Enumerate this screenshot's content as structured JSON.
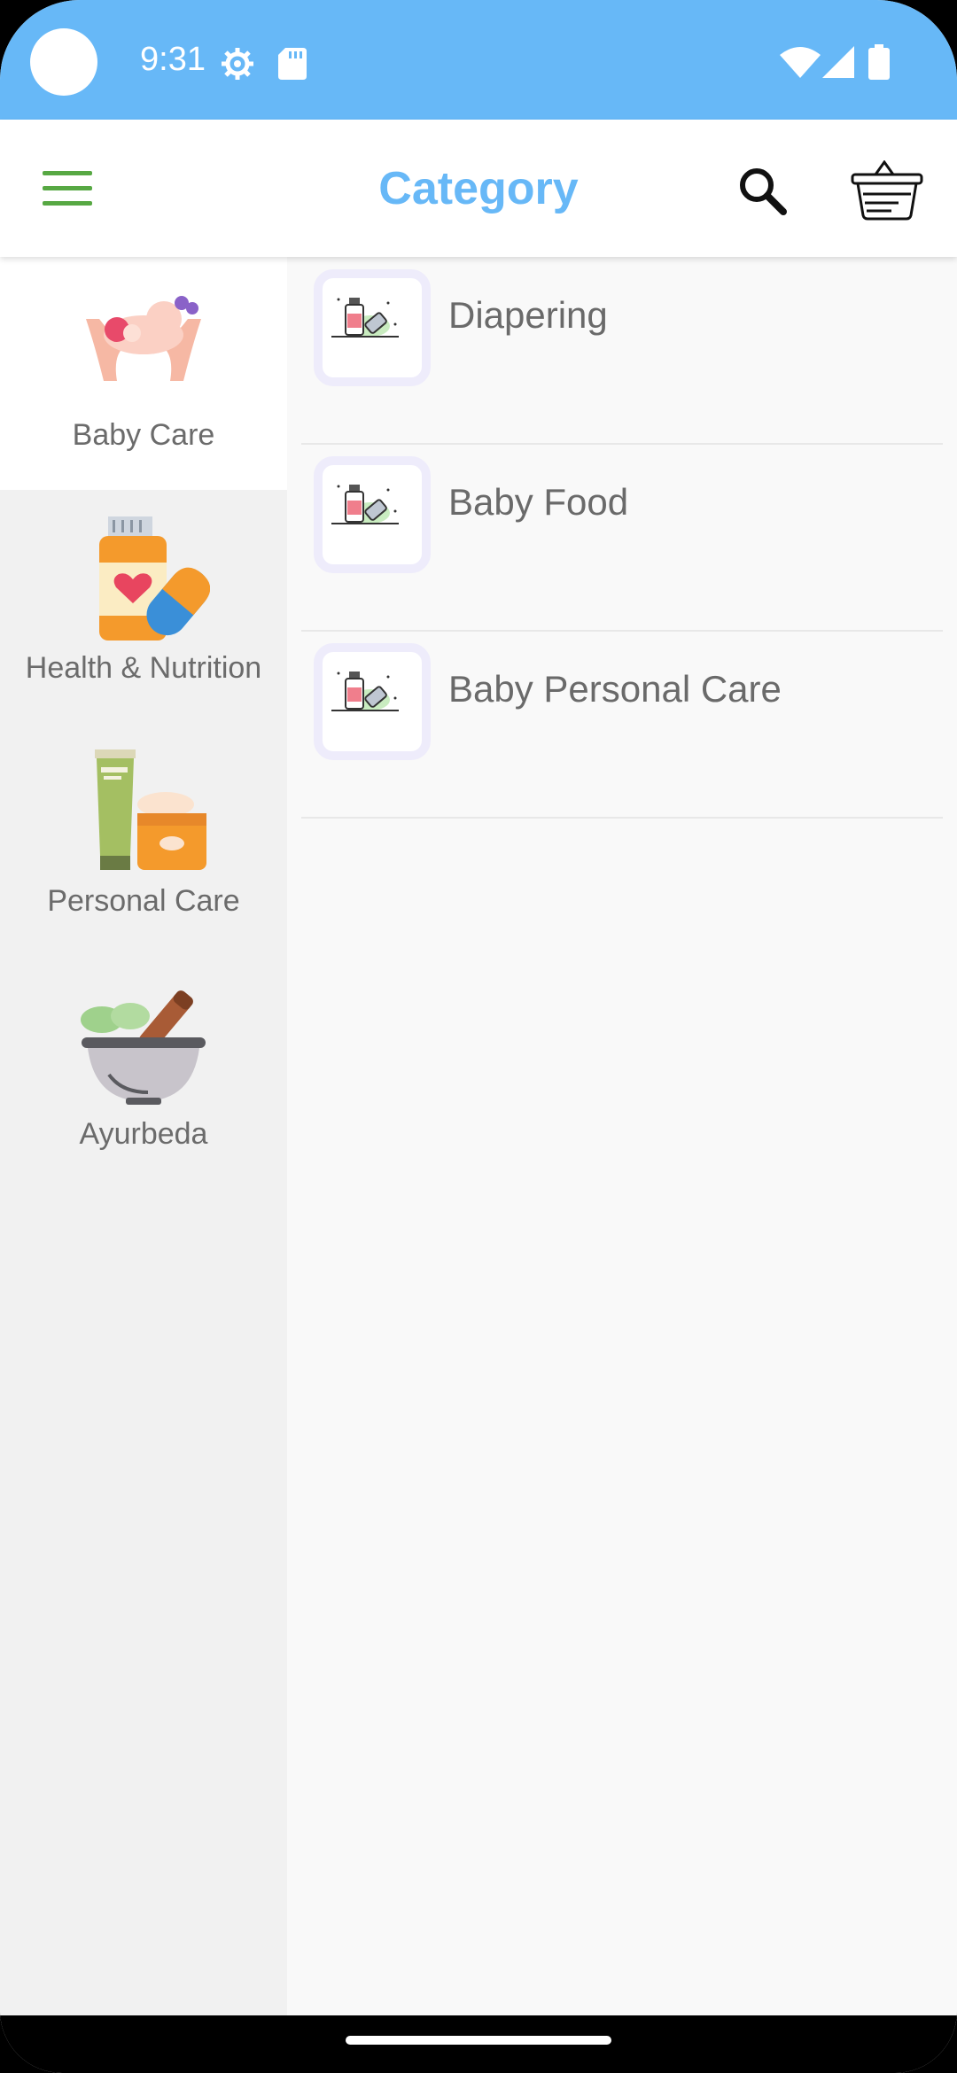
{
  "status_bar": {
    "time": "9:31",
    "icons": [
      "settings-icon",
      "sd-card-icon",
      "wifi-icon",
      "signal-icon",
      "battery-icon"
    ]
  },
  "app_bar": {
    "title": "Category",
    "menu_icon": "hamburger-menu-icon",
    "search_icon": "search-icon",
    "cart_icon": "basket-icon",
    "accent_color": "#67b8f7",
    "menu_color": "#57a843"
  },
  "sidebar": {
    "items": [
      {
        "label": "Baby Care",
        "icon": "baby-care-icon",
        "active": true
      },
      {
        "label": "Health & Nutrition",
        "icon": "health-nutrition-icon",
        "active": false
      },
      {
        "label": "Personal Care",
        "icon": "personal-care-icon",
        "active": false
      },
      {
        "label": "Ayurbeda",
        "icon": "ayurveda-icon",
        "active": false
      }
    ]
  },
  "subcategories": [
    {
      "label": "Diapering",
      "icon": "medicine-thumbnail-icon"
    },
    {
      "label": "Baby Food",
      "icon": "medicine-thumbnail-icon"
    },
    {
      "label": "Baby Personal Care",
      "icon": "medicine-thumbnail-icon"
    }
  ]
}
